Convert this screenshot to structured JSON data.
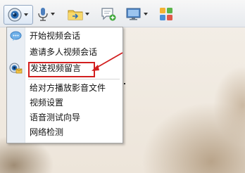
{
  "menu": {
    "items": [
      {
        "label": "开始视频会话"
      },
      {
        "label": "邀请多人视频会话"
      },
      {
        "label": "发送视频留言"
      },
      {
        "label": "给对方播放影音文件"
      },
      {
        "label": "视频设置"
      },
      {
        "label": "语音测试向导"
      },
      {
        "label": "网络检测"
      }
    ]
  },
  "icons": {
    "toolbar": [
      "video-camera-icon",
      "microphone-icon",
      "folder-transfer-icon",
      "chat-add-icon",
      "screen-share-icon",
      "apps-grid-icon"
    ],
    "menu": [
      "speech-bubble-icon",
      "video-message-icon"
    ]
  },
  "colors": {
    "annotation": "#d21f1f",
    "menu_gutter": "#e9eef4",
    "toolbar_bg": "#eceff3"
  }
}
